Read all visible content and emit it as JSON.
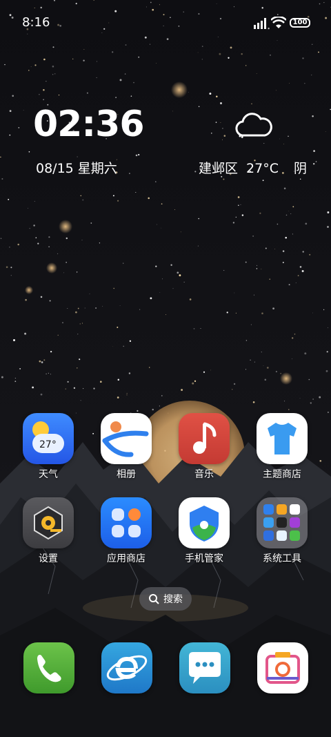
{
  "status_bar": {
    "time": "8:16",
    "battery": "100"
  },
  "clock_widget": {
    "time": "02:36",
    "date": "08/15 星期六",
    "location": "建邺区",
    "temperature": "27°C",
    "condition": "阴"
  },
  "apps": [
    {
      "label": "天气",
      "icon": "weather-icon",
      "badge": "27°"
    },
    {
      "label": "相册",
      "icon": "gallery-icon"
    },
    {
      "label": "音乐",
      "icon": "music-icon"
    },
    {
      "label": "主题商店",
      "icon": "theme-store-icon"
    },
    {
      "label": "设置",
      "icon": "settings-icon"
    },
    {
      "label": "应用商店",
      "icon": "app-store-icon"
    },
    {
      "label": "手机管家",
      "icon": "phone-manager-icon"
    },
    {
      "label": "系统工具",
      "icon": "system-tools-folder-icon"
    }
  ],
  "search": {
    "label": "搜索"
  },
  "dock": [
    {
      "icon": "phone-icon"
    },
    {
      "icon": "browser-icon"
    },
    {
      "icon": "messages-icon"
    },
    {
      "icon": "camera-icon"
    }
  ],
  "colors": {
    "weather_blue": "#2f73f5",
    "music_red": "#d8453b",
    "phone_green": "#4caf3a",
    "browser_teal": "#2fa0d8",
    "messages_teal": "#3aa9c8"
  }
}
